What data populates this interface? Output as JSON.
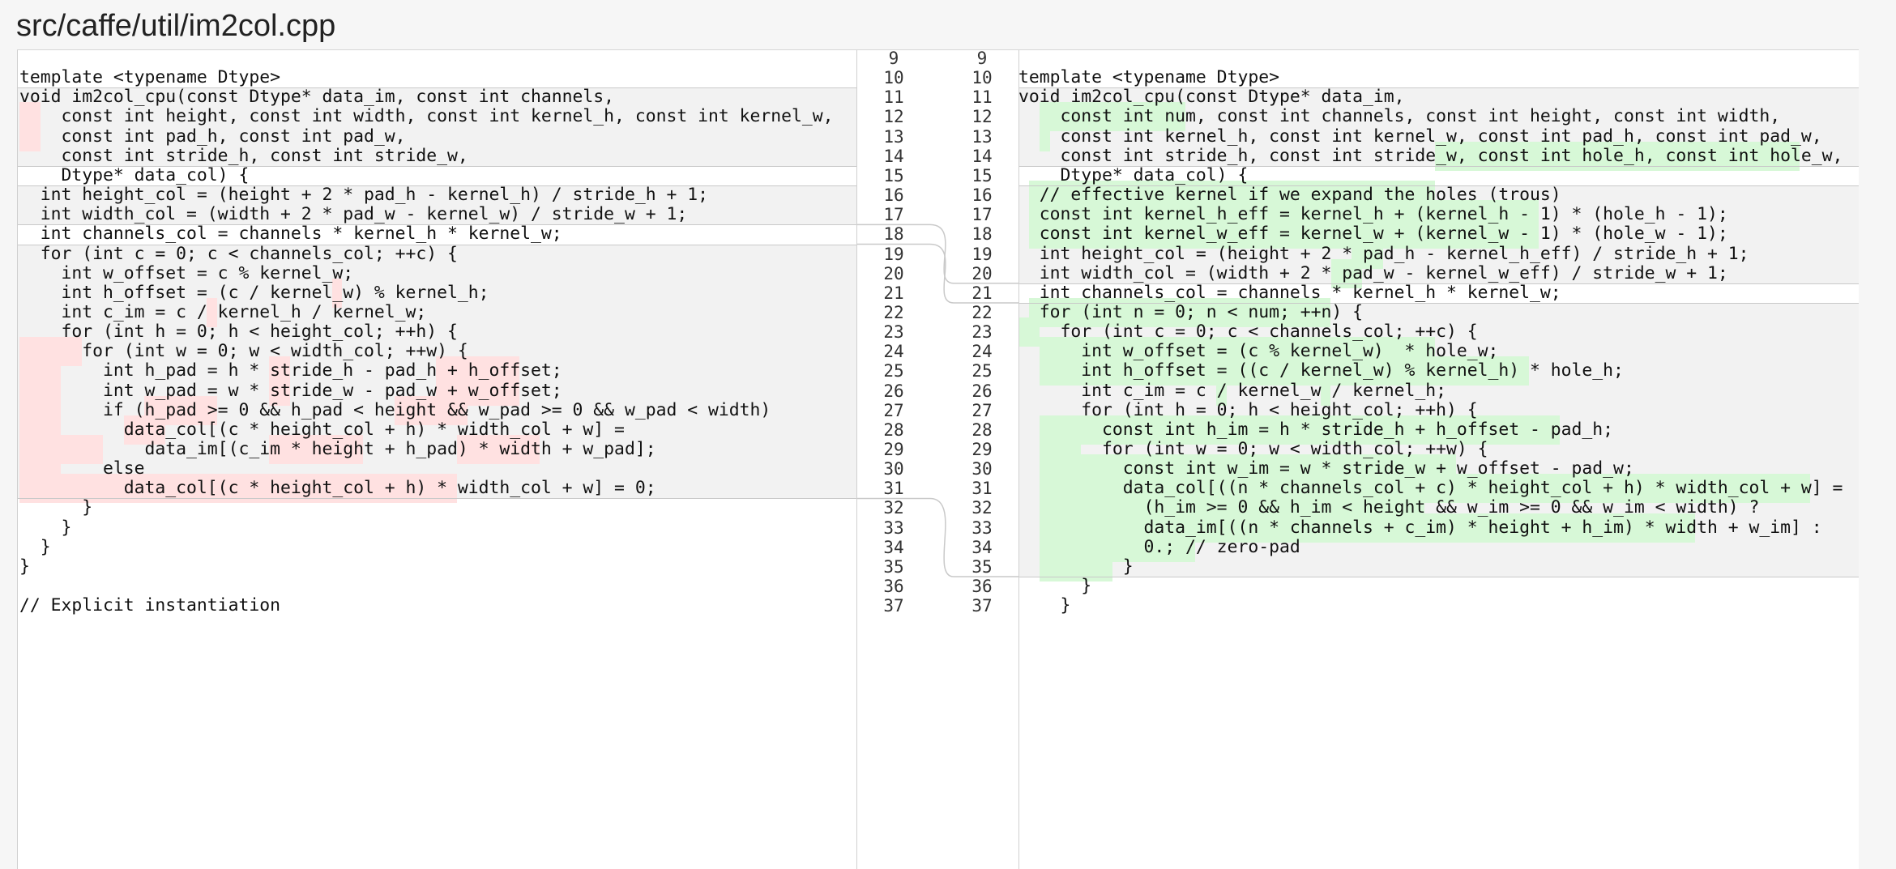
{
  "file": {
    "path": "src/caffe/util/im2col.cpp"
  },
  "colors": {
    "deleted_highlight": "#ffe1e1",
    "added_highlight": "#d7f8d7",
    "changed_band": "#f2f2f2",
    "separator": "#c9c9c9"
  },
  "gutter": {
    "old_numbers": [
      "9",
      "10",
      "11",
      "12",
      "13",
      "14",
      "15",
      "16",
      "17",
      "18",
      "19",
      "20",
      "21",
      "22",
      "23",
      "24",
      "25",
      "26",
      "27",
      "28",
      "29",
      "30",
      "31",
      "32",
      "33",
      "34",
      "35",
      "36",
      "37"
    ],
    "new_numbers": [
      "9",
      "10",
      "11",
      "12",
      "13",
      "14",
      "15",
      "16",
      "17",
      "18",
      "19",
      "20",
      "21",
      "22",
      "23",
      "24",
      "25",
      "26",
      "27",
      "28",
      "29",
      "30",
      "31",
      "32",
      "33",
      "34",
      "35",
      "36",
      "37"
    ]
  },
  "left": {
    "lines": [
      "",
      "template <typename Dtype>",
      "void im2col_cpu(const Dtype* data_im, const int channels,",
      "    const int height, const int width, const int kernel_h, const int kernel_w,",
      "    const int pad_h, const int pad_w,",
      "    const int stride_h, const int stride_w,",
      "    Dtype* data_col) {",
      "  int height_col = (height + 2 * pad_h - kernel_h) / stride_h + 1;",
      "  int width_col = (width + 2 * pad_w - kernel_w) / stride_w + 1;",
      "  int channels_col = channels * kernel_h * kernel_w;",
      "  for (int c = 0; c < channels_col; ++c) {",
      "    int w_offset = c % kernel_w;",
      "    int h_offset = (c / kernel_w) % kernel_h;",
      "    int c_im = c / kernel_h / kernel_w;",
      "    for (int h = 0; h < height_col; ++h) {",
      "      for (int w = 0; w < width_col; ++w) {",
      "        int h_pad = h * stride_h - pad_h + h_offset;",
      "        int w_pad = w * stride_w - pad_w + w_offset;",
      "        if (h_pad >= 0 && h_pad < height && w_pad >= 0 && w_pad < width)",
      "          data_col[(c * height_col + h) * width_col + w] =",
      "            data_im[(c_im * height + h_pad) * width + w_pad];",
      "        else",
      "          data_col[(c * height_col + h) * width_col + w] = 0;",
      "      }",
      "    }",
      "  }",
      "}",
      "",
      "// Explicit instantiation"
    ]
  },
  "right": {
    "lines": [
      "",
      "template <typename Dtype>",
      "void im2col_cpu(const Dtype* data_im,",
      "    const int num, const int channels, const int height, const int width,",
      "    const int kernel_h, const int kernel_w, const int pad_h, const int pad_w,",
      "    const int stride_h, const int stride_w, const int hole_h, const int hole_w,",
      "    Dtype* data_col) {",
      "  // effective kernel if we expand the holes (trous)",
      "  const int kernel_h_eff = kernel_h + (kernel_h - 1) * (hole_h - 1);",
      "  const int kernel_w_eff = kernel_w + (kernel_w - 1) * (hole_w - 1);",
      "  int height_col = (height + 2 * pad_h - kernel_h_eff) / stride_h + 1;",
      "  int width_col = (width + 2 * pad_w - kernel_w_eff) / stride_w + 1;",
      "  int channels_col = channels * kernel_h * kernel_w;",
      "  for (int n = 0; n < num; ++n) {",
      "    for (int c = 0; c < channels_col; ++c) {",
      "      int w_offset = (c % kernel_w)  * hole_w;",
      "      int h_offset = ((c / kernel_w) % kernel_h) * hole_h;",
      "      int c_im = c / kernel_w / kernel_h;",
      "      for (int h = 0; h < height_col; ++h) {",
      "        const int h_im = h * stride_h + h_offset - pad_h;",
      "        for (int w = 0; w < width_col; ++w) {",
      "          const int w_im = w * stride_w + w_offset - pad_w;",
      "          data_col[((n * channels_col + c) * height_col + h) * width_col + w] =",
      "            (h_im >= 0 && h_im < height && w_im >= 0 && w_im < width) ?",
      "            data_im[((n * channels + c_im) * height + h_im) * width + w_im] :",
      "            0.; // zero-pad",
      "          }",
      "      }",
      "    }"
    ]
  }
}
